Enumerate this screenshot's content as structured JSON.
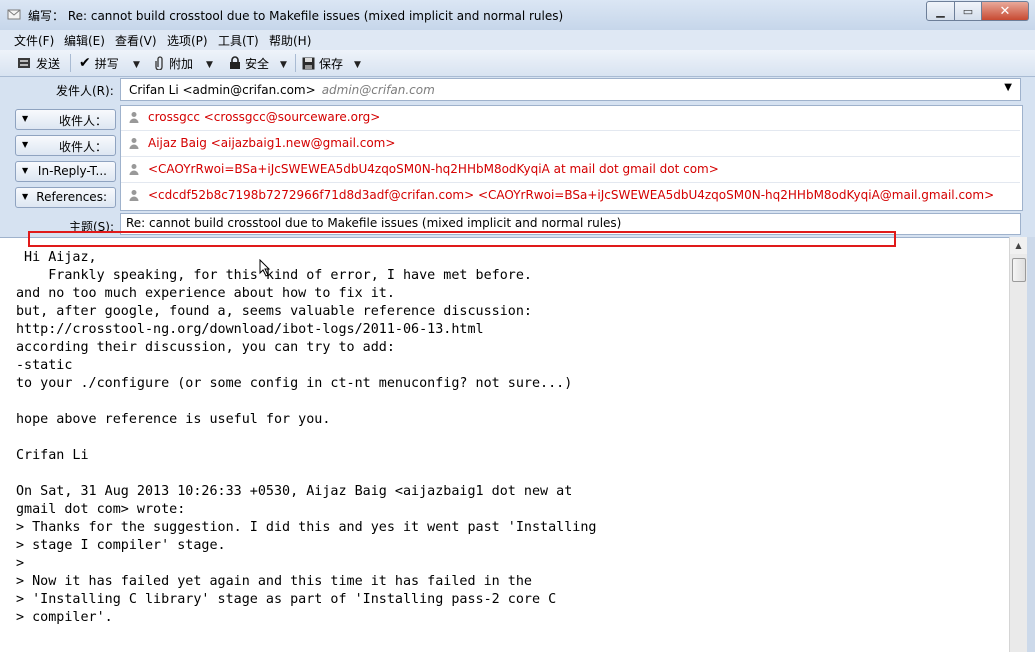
{
  "window": {
    "title": "编写： Re: cannot build crosstool due to Makefile issues (mixed implicit and normal rules)"
  },
  "menu": {
    "items": [
      "文件(F)",
      "编辑(E)",
      "查看(V)",
      "选项(P)",
      "工具(T)",
      "帮助(H)"
    ]
  },
  "toolbar": {
    "send": "发送",
    "spell": "拼写",
    "attach": "附加",
    "security": "安全",
    "save": "保存"
  },
  "header": {
    "from_label": "发件人(R):",
    "from_name": "Crifan Li <admin@crifan.com>",
    "from_alias": "admin@crifan.com",
    "recipients": [
      {
        "label": "收件人：",
        "value": "crossgcc <crossgcc@sourceware.org>"
      },
      {
        "label": "收件人：",
        "value": "Aijaz Baig <aijazbaig1.new@gmail.com>"
      },
      {
        "label": "In-Reply-T...",
        "value": "<CAOYrRwoi=BSa+iJcSWEWEA5dbU4zqoSM0N-hq2HHbM8odKyqiA at mail dot gmail dot com>"
      },
      {
        "label": "References:",
        "value": "<cdcdf52b8c7198b7272966f71d8d3adf@crifan.com> <CAOYrRwoi=BSa+iJcSWEWEA5dbU4zqoSM0N-hq2HHbM8odKyqiA@mail.gmail.com>"
      }
    ],
    "subject_label": "主题(S):",
    "subject": "Re: cannot build crosstool due to Makefile issues (mixed implicit and normal rules)"
  },
  "body": {
    "text": " Hi Aijaz,\n    Frankly speaking, for this kind of error, I have met before.\nand no too much experience about how to fix it.\nbut, after google, found a, seems valuable reference discussion:\nhttp://crosstool-ng.org/download/ibot-logs/2011-06-13.html\naccording their discussion, you can try to add:\n-static\nto your ./configure (or some config in ct-nt menuconfig? not sure...)\n\nhope above reference is useful for you.\n\nCrifan Li\n\nOn Sat, 31 Aug 2013 10:26:33 +0530, Aijaz Baig <aijazbaig1 dot new at\ngmail dot com> wrote:\n> Thanks for the suggestion. I did this and yes it went past 'Installing\n> stage I compiler' stage.\n>\n> Now it has failed yet again and this time it has failed in the\n> 'Installing C library' stage as part of 'Installing pass-2 core C\n> compiler'."
  },
  "colors": {
    "recipient_text": "#d40000",
    "highlight_box": "#e01a1a"
  }
}
